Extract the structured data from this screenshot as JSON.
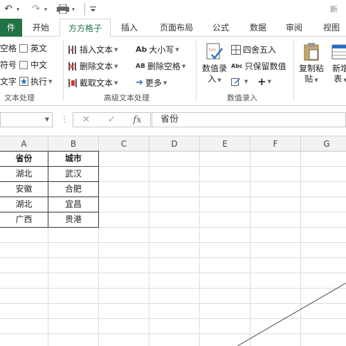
{
  "quick_access": {
    "undo": "↶",
    "redo": "↷",
    "title": "新"
  },
  "tabs": [
    {
      "label": "件"
    },
    {
      "label": "开始"
    },
    {
      "label": "方方格子"
    },
    {
      "label": "插入"
    },
    {
      "label": "页面布局"
    },
    {
      "label": "公式"
    },
    {
      "label": "数据"
    },
    {
      "label": "审阅"
    },
    {
      "label": "视图"
    }
  ],
  "ribbon": {
    "text_processing": {
      "items": [
        "空格",
        "符号",
        "文字"
      ],
      "checks": [
        "英文",
        "中文"
      ],
      "execute": "执行",
      "group_label": "文本处理"
    },
    "advanced_text": {
      "insert_text": "插入文本",
      "delete_text": "删除文本",
      "extract_text": "截取文本",
      "case": "大小写",
      "delete_space": "删除空格",
      "more": "更多",
      "group_label": "高级文本处理"
    },
    "numeric_entry": {
      "big_button": [
        "数值录",
        "入"
      ],
      "round": "四舍五入",
      "keep_value": "只保留数值",
      "plus": "+",
      "group_label": "数值录入"
    },
    "paste": {
      "copy_paste": [
        "复制粘",
        "贴"
      ],
      "new": [
        "新增",
        "表"
      ]
    }
  },
  "formula_bar": {
    "cancel": "✕",
    "confirm": "✓",
    "fx": "fx",
    "content": "省份"
  },
  "sheet": {
    "columns": [
      "A",
      "B",
      "C",
      "D",
      "E",
      "F",
      "G"
    ],
    "table": [
      [
        "省份",
        "城市"
      ],
      [
        "湖北",
        "武汉"
      ],
      [
        "安徽",
        "合肥"
      ],
      [
        "湖北",
        "宜昌"
      ],
      [
        "广西",
        "贵港"
      ]
    ]
  }
}
